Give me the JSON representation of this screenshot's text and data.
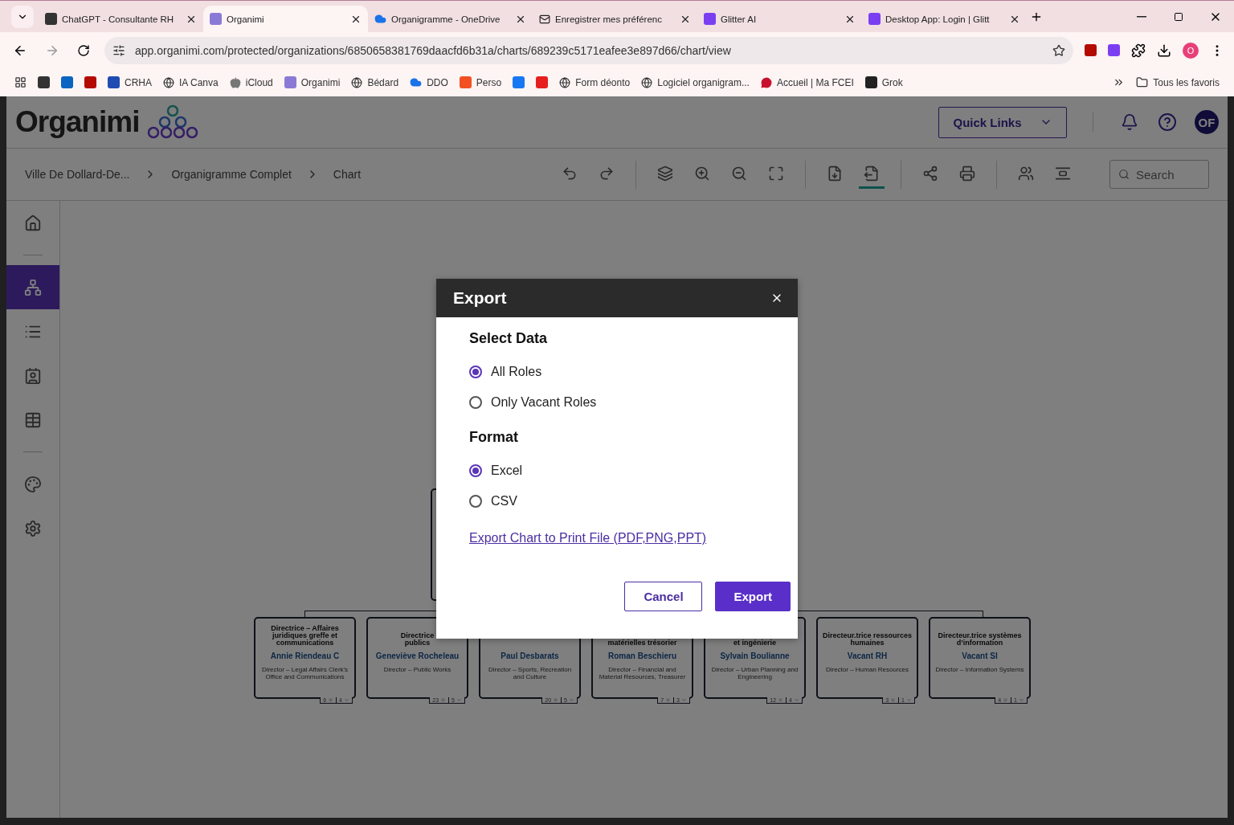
{
  "browser": {
    "tabs": [
      {
        "title": "ChatGPT - Consultante RH",
        "kind": "openai",
        "selected": false
      },
      {
        "title": "Organimi",
        "kind": "organimi",
        "selected": true
      },
      {
        "title": "Organigramme - OneDrive",
        "kind": "cloud",
        "selected": false
      },
      {
        "title": "Enregistrer mes préférenc",
        "kind": "mail",
        "selected": false
      },
      {
        "title": "Glitter AI",
        "kind": "glitter",
        "selected": false
      },
      {
        "title": "Desktop App: Login | Glitt",
        "kind": "glitter",
        "selected": false
      }
    ],
    "url": "app.organimi.com/protected/organizations/6850658381769daacfd6b31a/charts/689239c5171eafee3e897d66/chart/view",
    "profile": "O",
    "bookmarks": [
      {
        "kind": "openai"
      },
      {
        "kind": "outlook"
      },
      {
        "kind": "pdf"
      },
      {
        "label": "CRHA",
        "kind": "crha"
      },
      {
        "label": "IA Canva",
        "kind": "globe"
      },
      {
        "label": "iCloud",
        "kind": "apple"
      },
      {
        "label": "Organimi",
        "kind": "organimi"
      },
      {
        "label": "Bédard",
        "kind": "globe"
      },
      {
        "label": "DDO",
        "kind": "cloud"
      },
      {
        "label": "Perso",
        "kind": "windows"
      },
      {
        "kind": "facebook"
      },
      {
        "kind": "adobe"
      },
      {
        "label": "Form déonto",
        "kind": "globe"
      },
      {
        "label": "Logiciel organigram...",
        "kind": "globe"
      },
      {
        "label": "Accueil | Ma FCEI",
        "kind": "chat"
      },
      {
        "label": "Grok",
        "kind": "grok"
      }
    ],
    "all_bookmarks": "Tous les favoris"
  },
  "app": {
    "logo": "Organimi",
    "quick_links": "Quick Links",
    "avatar": "OF",
    "breadcrumbs": [
      "Ville De Dollard-De...",
      "Organigramme Complet",
      "Chart"
    ],
    "toolbar": [
      [
        {
          "kind": "undo",
          "selected": false
        },
        {
          "kind": "redo",
          "selected": false
        }
      ],
      [
        {
          "kind": "layers",
          "selected": false
        },
        {
          "kind": "zoom-in",
          "selected": false
        },
        {
          "kind": "zoom-out",
          "selected": false
        },
        {
          "kind": "fit",
          "selected": false
        }
      ],
      [
        {
          "kind": "import",
          "selected": false
        },
        {
          "kind": "export",
          "selected": true
        }
      ],
      [
        {
          "kind": "share",
          "selected": false
        },
        {
          "kind": "print",
          "selected": false
        }
      ],
      [
        {
          "kind": "people",
          "selected": false
        },
        {
          "kind": "align",
          "selected": false
        }
      ]
    ],
    "search": {
      "placeholder": "Search"
    },
    "sidebar": [
      [
        {
          "kind": "home",
          "selected": false
        }
      ],
      [
        {
          "kind": "chart",
          "selected": true
        },
        {
          "kind": "list",
          "selected": false
        },
        {
          "kind": "profile",
          "selected": false
        },
        {
          "kind": "table",
          "selected": false
        }
      ],
      [
        {
          "kind": "palette",
          "selected": false
        },
        {
          "kind": "settings",
          "selected": false
        }
      ]
    ],
    "chart_nodes": [
      {
        "title": "Directrice – Affaires juridiques greffe et communications",
        "name": "Annie Riendeau C",
        "role": "Director – Legal Affairs Clerk's Office and Communications",
        "count_1": "6",
        "count_2": "4"
      },
      {
        "title": "Directrice\npublics",
        "name": "Geneviève Rocheleau",
        "role": "Director – Public Works",
        "count_1": "23",
        "count_2": "5"
      },
      {
        "name": "Paul Desbarats",
        "role": "Director – Sports, Recreation and Culture",
        "count_1": "20",
        "count_2": "5"
      },
      {
        "title": "matérielles trésorier",
        "name": "Roman Beschieru",
        "role": "Director – Financial and Material Resources, Treasurer",
        "count_1": "7",
        "count_2": "3"
      },
      {
        "title": "et ingénierie",
        "name": "Sylvain Boulianne",
        "role": "Director – Urban Planning and Engineering",
        "count_1": "12",
        "count_2": "4"
      },
      {
        "title": "Directeur.trice ressources humaines",
        "name": "Vacant RH",
        "role": "Director – Human Resources",
        "count_1": "3",
        "count_2": "1"
      },
      {
        "title": "Directeur.trice systèmes d’information",
        "name": "Vacant SI",
        "role": "Director – Information Systems",
        "count_1": "4",
        "count_2": "1"
      }
    ]
  },
  "dialog": {
    "title": "Export",
    "sections": [
      {
        "heading": "Select Data",
        "options": [
          {
            "label": "All Roles",
            "selected": true
          },
          {
            "label": "Only Vacant Roles",
            "selected": false
          }
        ]
      },
      {
        "heading": "Format",
        "options": [
          {
            "label": "Excel",
            "selected": true
          },
          {
            "label": "CSV",
            "selected": false
          }
        ]
      }
    ],
    "link": "Export Chart to Print File (PDF,PNG,PPT)",
    "buttons": [
      {
        "label": "Cancel",
        "kind": "secondary"
      },
      {
        "label": "Export",
        "kind": "primary"
      }
    ]
  }
}
